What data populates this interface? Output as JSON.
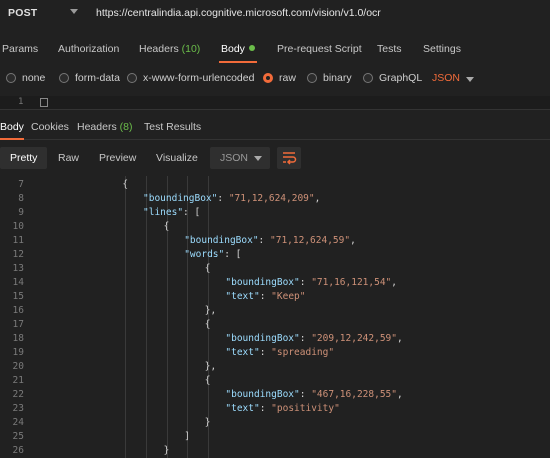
{
  "request": {
    "method": "POST",
    "url": "https://centralindia.api.cognitive.microsoft.com/vision/v1.0/ocr"
  },
  "request_tabs": [
    {
      "label": "Params",
      "count": ""
    },
    {
      "label": "Authorization",
      "count": ""
    },
    {
      "label": "Headers",
      "count": "(10)"
    },
    {
      "label": "Body",
      "count": ""
    },
    {
      "label": "Pre-request Script",
      "count": ""
    },
    {
      "label": "Tests",
      "count": ""
    },
    {
      "label": "Settings",
      "count": ""
    }
  ],
  "active_request_tab": "Body",
  "body_types": [
    "none",
    "form-data",
    "x-www-form-urlencoded",
    "raw",
    "binary",
    "GraphQL"
  ],
  "selected_body_type": "raw",
  "body_format": "JSON",
  "request_editor": {
    "line_number": "1"
  },
  "response_tabs": [
    {
      "label": "Body",
      "count": ""
    },
    {
      "label": "Cookies",
      "count": ""
    },
    {
      "label": "Headers",
      "count": "(8)"
    },
    {
      "label": "Test Results",
      "count": ""
    }
  ],
  "active_response_tab": "Body",
  "view_modes": [
    "Pretty",
    "Raw",
    "Preview",
    "Visualize"
  ],
  "active_view_mode": "Pretty",
  "response_format": "JSON",
  "response_lines": [
    {
      "n": "7",
      "indent": 4,
      "parts": [
        [
          "pun",
          "{"
        ]
      ]
    },
    {
      "n": "8",
      "indent": 5,
      "parts": [
        [
          "key",
          "\"boundingBox\""
        ],
        [
          "pun",
          ": "
        ],
        [
          "str",
          "\"71,12,624,209\""
        ],
        [
          "pun",
          ","
        ]
      ]
    },
    {
      "n": "9",
      "indent": 5,
      "parts": [
        [
          "key",
          "\"lines\""
        ],
        [
          "pun",
          ": ["
        ]
      ]
    },
    {
      "n": "10",
      "indent": 6,
      "parts": [
        [
          "pun",
          "{"
        ]
      ]
    },
    {
      "n": "11",
      "indent": 7,
      "parts": [
        [
          "key",
          "\"boundingBox\""
        ],
        [
          "pun",
          ": "
        ],
        [
          "str",
          "\"71,12,624,59\""
        ],
        [
          "pun",
          ","
        ]
      ]
    },
    {
      "n": "12",
      "indent": 7,
      "parts": [
        [
          "key",
          "\"words\""
        ],
        [
          "pun",
          ": ["
        ]
      ]
    },
    {
      "n": "13",
      "indent": 8,
      "parts": [
        [
          "pun",
          "{"
        ]
      ]
    },
    {
      "n": "14",
      "indent": 9,
      "parts": [
        [
          "key",
          "\"boundingBox\""
        ],
        [
          "pun",
          ": "
        ],
        [
          "str",
          "\"71,16,121,54\""
        ],
        [
          "pun",
          ","
        ]
      ]
    },
    {
      "n": "15",
      "indent": 9,
      "parts": [
        [
          "key",
          "\"text\""
        ],
        [
          "pun",
          ": "
        ],
        [
          "str",
          "\"Keep\""
        ]
      ]
    },
    {
      "n": "16",
      "indent": 8,
      "parts": [
        [
          "pun",
          "},"
        ]
      ]
    },
    {
      "n": "17",
      "indent": 8,
      "parts": [
        [
          "pun",
          "{"
        ]
      ]
    },
    {
      "n": "18",
      "indent": 9,
      "parts": [
        [
          "key",
          "\"boundingBox\""
        ],
        [
          "pun",
          ": "
        ],
        [
          "str",
          "\"209,12,242,59\""
        ],
        [
          "pun",
          ","
        ]
      ]
    },
    {
      "n": "19",
      "indent": 9,
      "parts": [
        [
          "key",
          "\"text\""
        ],
        [
          "pun",
          ": "
        ],
        [
          "str",
          "\"spreading\""
        ]
      ]
    },
    {
      "n": "20",
      "indent": 8,
      "parts": [
        [
          "pun",
          "},"
        ]
      ]
    },
    {
      "n": "21",
      "indent": 8,
      "parts": [
        [
          "pun",
          "{"
        ]
      ]
    },
    {
      "n": "22",
      "indent": 9,
      "parts": [
        [
          "key",
          "\"boundingBox\""
        ],
        [
          "pun",
          ": "
        ],
        [
          "str",
          "\"467,16,228,55\""
        ],
        [
          "pun",
          ","
        ]
      ]
    },
    {
      "n": "23",
      "indent": 9,
      "parts": [
        [
          "key",
          "\"text\""
        ],
        [
          "pun",
          ": "
        ],
        [
          "str",
          "\"positivity\""
        ]
      ]
    },
    {
      "n": "24",
      "indent": 8,
      "parts": [
        [
          "pun",
          "}"
        ]
      ]
    },
    {
      "n": "25",
      "indent": 7,
      "parts": [
        [
          "pun",
          "]"
        ]
      ]
    },
    {
      "n": "26",
      "indent": 6,
      "parts": [
        [
          "pun",
          "}"
        ]
      ]
    }
  ],
  "colors": {
    "accent": "#f26b3a",
    "count_green": "#6bbd4a",
    "json_key": "#9cdcfe",
    "json_string": "#ce9178"
  },
  "icons": {
    "method_dropdown": "chevron-down-icon",
    "body_format_dropdown": "chevron-down-icon",
    "response_format_dropdown": "chevron-down-icon",
    "wrap": "wrap-lines-icon",
    "body_indicator": "green-dot-icon"
  }
}
